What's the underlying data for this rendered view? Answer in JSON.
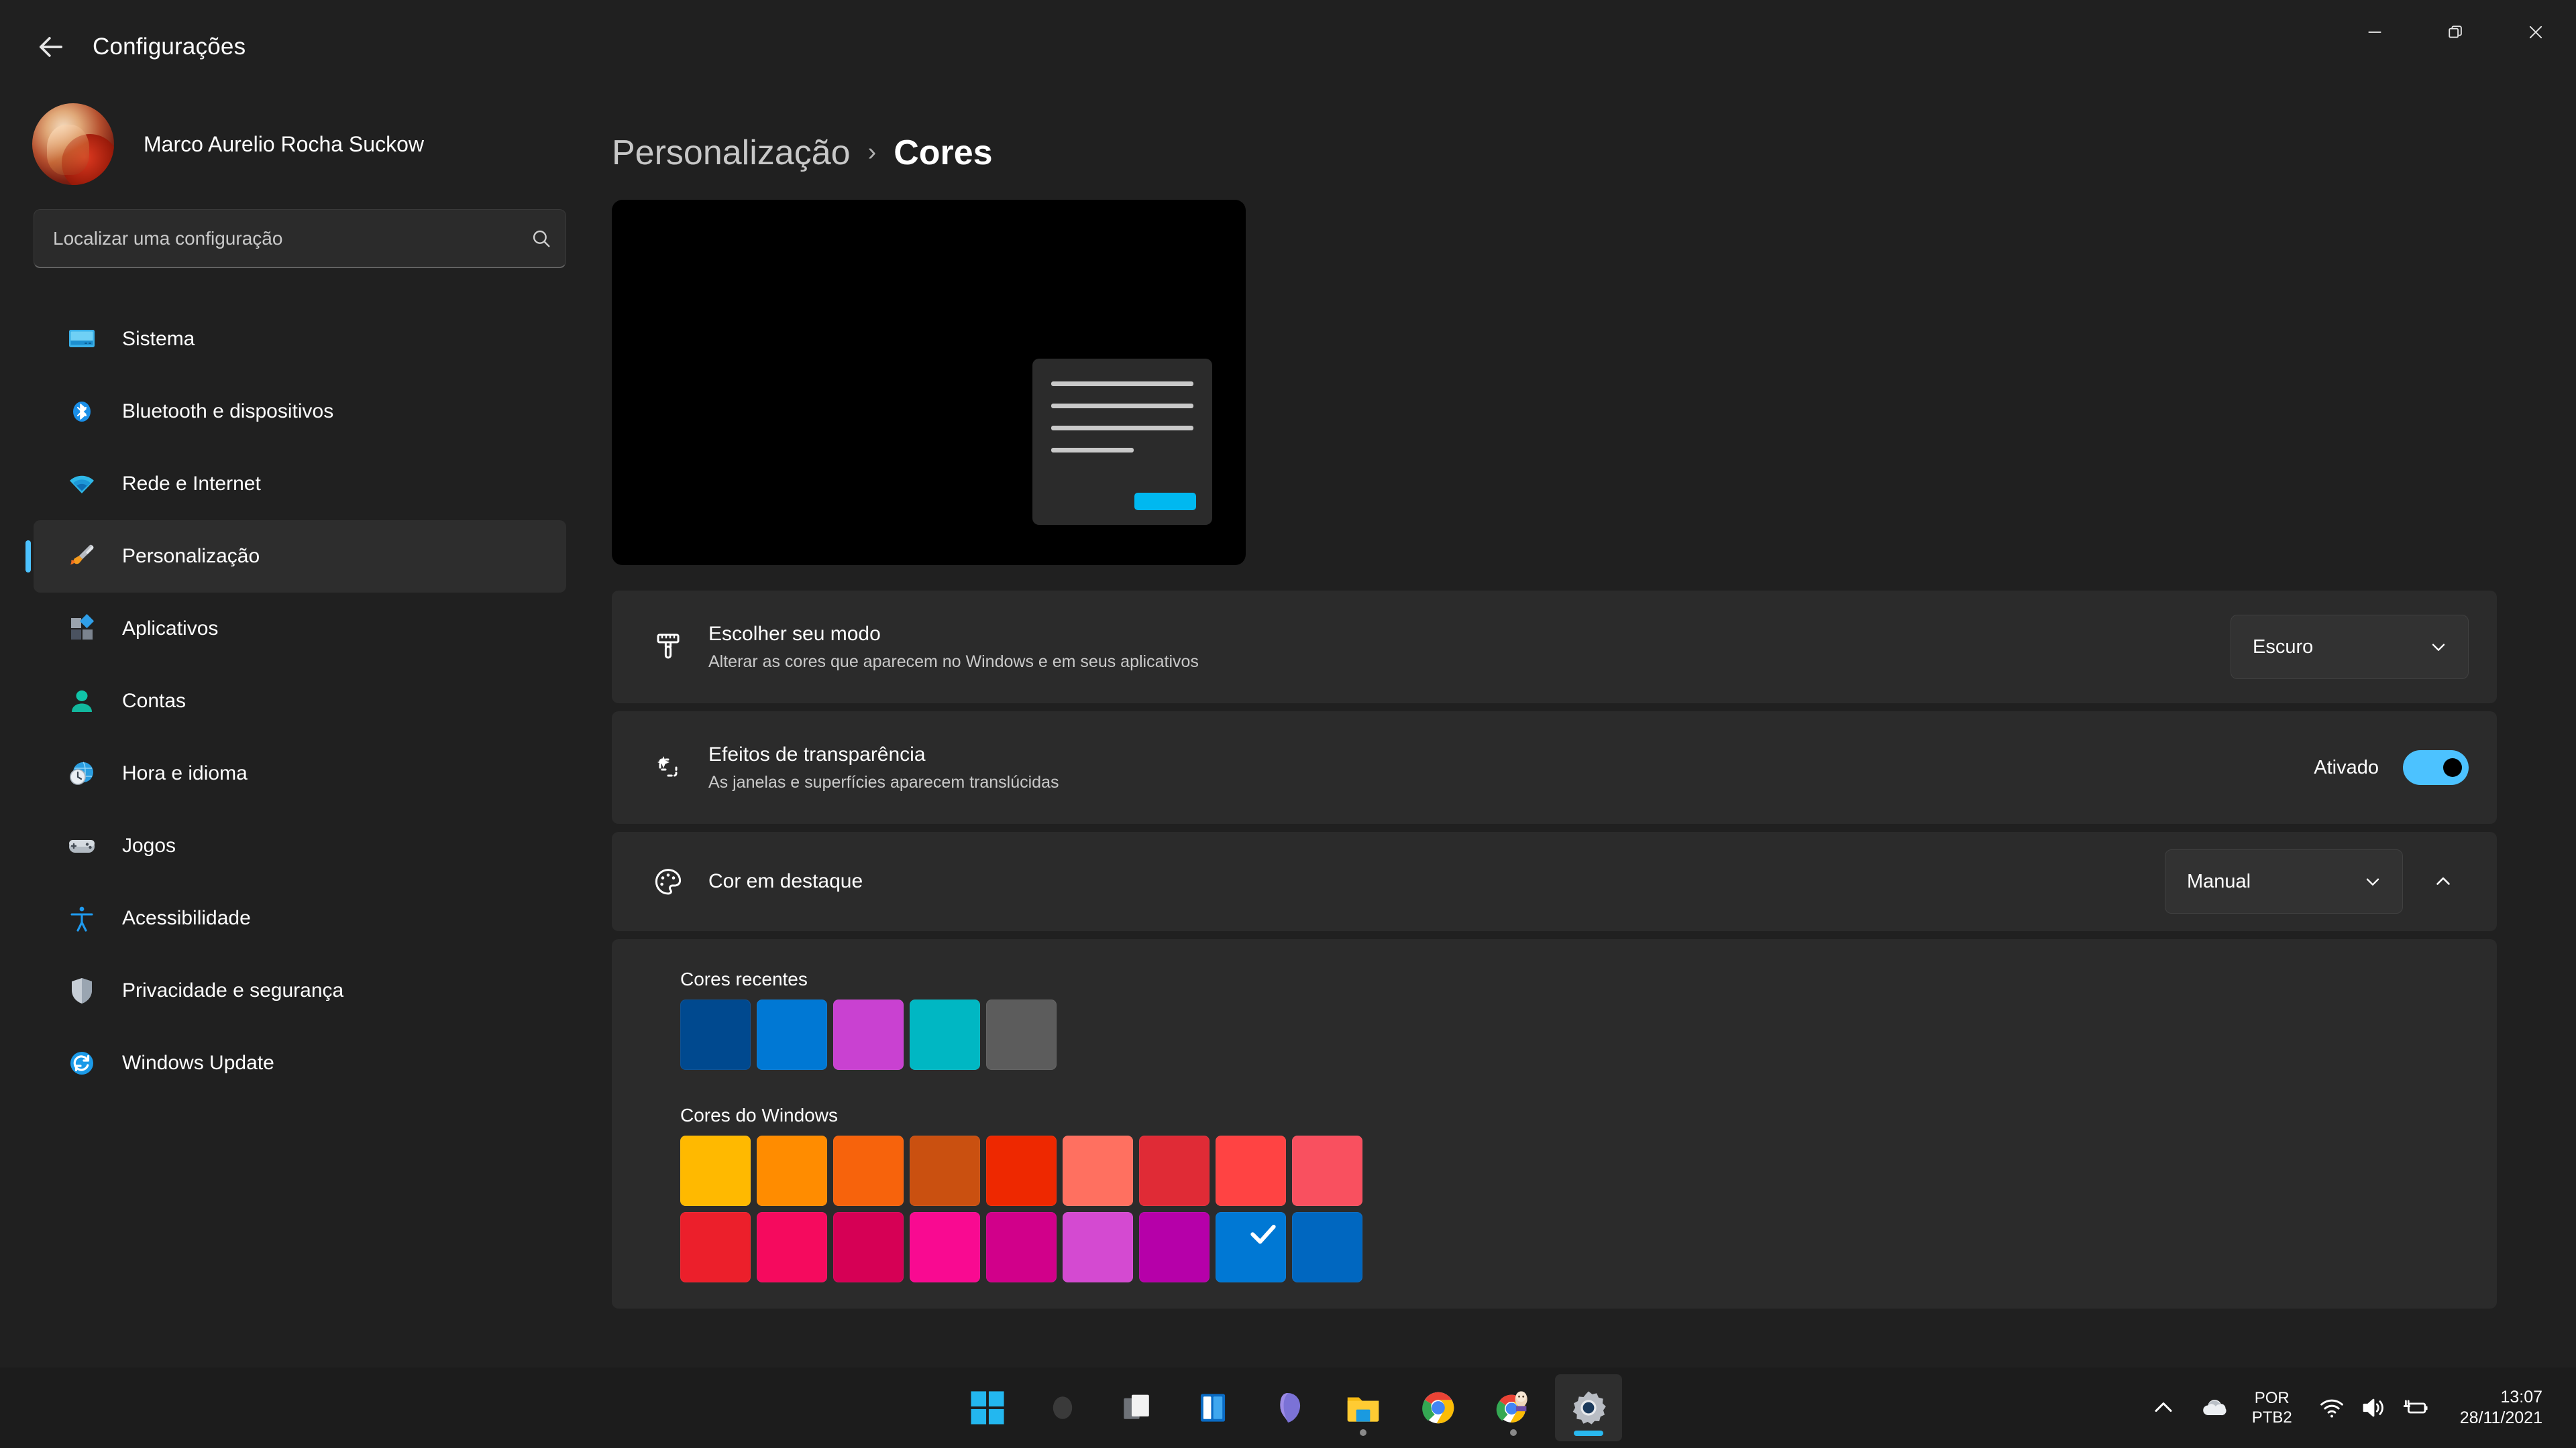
{
  "window": {
    "app_title": "Configurações",
    "back_icon": "arrow-left-icon",
    "minimize_label": "Minimizar",
    "maximize_label": "Restaurar",
    "close_label": "Fechar"
  },
  "sidebar": {
    "profile": {
      "name": "Marco Aurelio Rocha Suckow",
      "avatar_icon": "user-avatar"
    },
    "search": {
      "placeholder": "Localizar uma configuração",
      "value": "",
      "icon": "search-icon"
    },
    "items": [
      {
        "label": "Sistema",
        "icon": "monitor-icon",
        "active": false
      },
      {
        "label": "Bluetooth e dispositivos",
        "icon": "bluetooth-icon",
        "active": false
      },
      {
        "label": "Rede e Internet",
        "icon": "wifi-icon",
        "active": false
      },
      {
        "label": "Personalização",
        "icon": "paintbrush-icon",
        "active": true
      },
      {
        "label": "Aplicativos",
        "icon": "apps-icon",
        "active": false
      },
      {
        "label": "Contas",
        "icon": "account-icon",
        "active": false
      },
      {
        "label": "Hora e idioma",
        "icon": "clock-globe-icon",
        "active": false
      },
      {
        "label": "Jogos",
        "icon": "gamepad-icon",
        "active": false
      },
      {
        "label": "Acessibilidade",
        "icon": "accessibility-icon",
        "active": false
      },
      {
        "label": "Privacidade e segurança",
        "icon": "shield-icon",
        "active": false
      },
      {
        "label": "Windows Update",
        "icon": "update-icon",
        "active": false
      }
    ]
  },
  "main": {
    "breadcrumb": {
      "parent": "Personalização",
      "separator": "›",
      "current": "Cores"
    },
    "preview": {
      "accent_color": "#00b8f0",
      "window_background": "#2b2b2b",
      "desktop_background": "#000000"
    },
    "rows": [
      {
        "title": "Escolher seu modo",
        "subtitle": "Alterar as cores que aparecem no Windows e em seus aplicativos",
        "icon": "paintbrush-icon",
        "control": "dropdown",
        "value": "Escuro",
        "chevron": "chevron-down-icon"
      },
      {
        "title": "Efeitos de transparência",
        "subtitle": "As janelas e superfícies aparecem translúcidas",
        "icon": "transparency-icon",
        "control": "toggle",
        "value": "Ativado",
        "toggle_on": true
      },
      {
        "title": "Cor em destaque",
        "subtitle": "",
        "icon": "palette-icon",
        "control": "dropdown-expander",
        "value": "Manual",
        "chevron": "chevron-down-icon",
        "expander_icon": "chevron-up-icon",
        "expanded": true
      }
    ],
    "recent_colors": {
      "label": "Cores recentes",
      "swatches": [
        "#00498f",
        "#0078d4",
        "#c941d1",
        "#00b7c3",
        "#5c5c5c"
      ]
    },
    "windows_colors": {
      "label": "Cores do Windows",
      "rows": [
        [
          "#ffb900",
          "#ff8c00",
          "#f7630c",
          "#ca5010",
          "#ee2800",
          "#ff7060",
          "#e02b36",
          "#ff4343",
          "#f9505f"
        ],
        [
          "#ec1f2b",
          "#f50a5e",
          "#d60055",
          "#f90a91",
          "#d1008a",
          "#d44ad1",
          "#b600a9",
          "#0078d4",
          "#0067c0"
        ]
      ],
      "selected_index_row": 1,
      "selected_index_col": 7,
      "check_icon": "check-icon"
    }
  },
  "taskbar": {
    "buttons": [
      {
        "name": "start",
        "icon": "windows-logo-icon",
        "running": false,
        "active": false
      },
      {
        "name": "search",
        "icon": "search-circle-icon",
        "running": false,
        "active": false
      },
      {
        "name": "task-view",
        "icon": "task-view-icon",
        "running": false,
        "active": false
      },
      {
        "name": "widgets",
        "icon": "widgets-icon",
        "running": false,
        "active": false
      },
      {
        "name": "chat",
        "icon": "teams-chat-icon",
        "running": false,
        "active": false
      },
      {
        "name": "file-explorer",
        "icon": "folder-icon",
        "running": true,
        "active": false
      },
      {
        "name": "chrome",
        "icon": "chrome-icon",
        "running": false,
        "active": false
      },
      {
        "name": "chrome-profile",
        "icon": "chrome-profile-icon",
        "running": true,
        "active": false
      },
      {
        "name": "settings",
        "icon": "gear-icon",
        "running": true,
        "active": true
      }
    ],
    "tray": {
      "overflow_icon": "chevron-up-icon",
      "onedrive_icon": "cloud-icon",
      "language_line1": "POR",
      "language_line2": "PTB2",
      "wifi_icon": "wifi-icon",
      "volume_icon": "speaker-icon",
      "battery_icon": "battery-charging-icon",
      "time": "13:07",
      "date": "28/11/2021"
    }
  },
  "colors": {
    "accent": "#4cc2ff",
    "window_bg": "#202020",
    "card_bg": "#2b2b2b",
    "taskbar_bg": "#1c1c1c"
  }
}
